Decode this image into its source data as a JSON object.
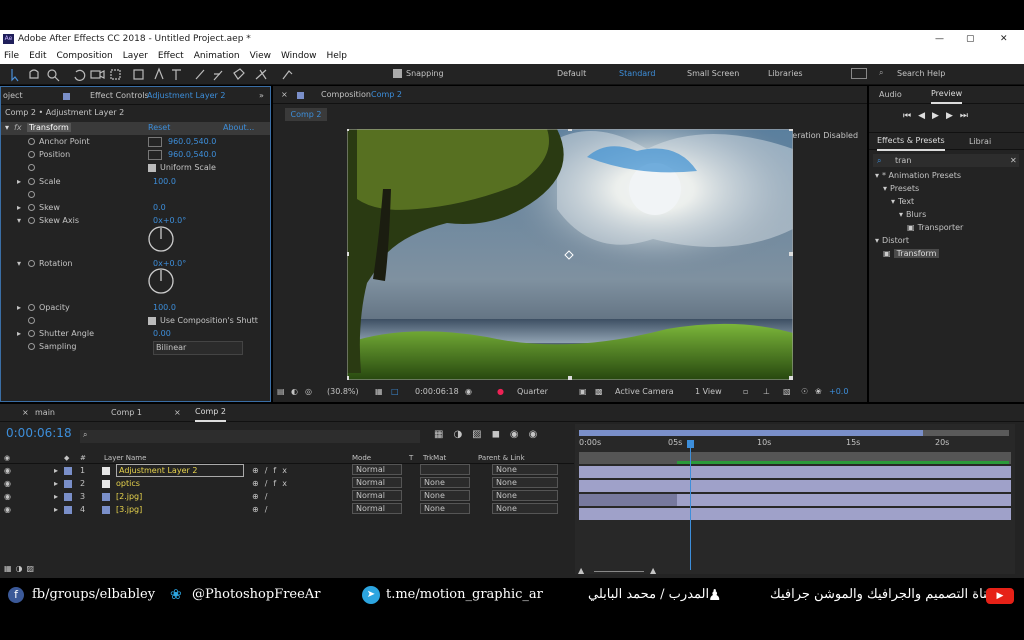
{
  "window": {
    "app_icon": "Ae",
    "title": "Adobe After Effects CC 2018 - Untitled Project.aep *",
    "min": "—",
    "max": "▢",
    "close": "✕"
  },
  "menu": [
    "File",
    "Edit",
    "Composition",
    "Layer",
    "Effect",
    "Animation",
    "View",
    "Window",
    "Help"
  ],
  "toolbar": {
    "snapping": "Snapping",
    "workspaces": [
      "Default",
      "Standard",
      "Small Screen",
      "Libraries"
    ],
    "active_workspace": "Standard",
    "search_help": "Search Help"
  },
  "effect_controls": {
    "project_tab": "oject",
    "tab_label": "Effect Controls",
    "tab_layer": "Adjustment Layer 2",
    "comp_layer": "Comp 2 • Adjustment Layer 2",
    "fx": "fx",
    "effect_name": "Transform",
    "reset": "Reset",
    "about": "About...",
    "props": [
      {
        "name": "Anchor Point",
        "value": "960.0,540.0"
      },
      {
        "name": "Position",
        "value": "960.0,540.0"
      },
      {
        "name": "",
        "value": "Uniform Scale",
        "checkbox": true
      },
      {
        "name": "Scale",
        "value": "100.0"
      },
      {
        "name": "",
        "value": ""
      },
      {
        "name": "Skew",
        "value": "0.0"
      },
      {
        "name": "Skew Axis",
        "value": "0x+0.0°"
      },
      {
        "name": "Rotation",
        "value": "0x+0.0°"
      },
      {
        "name": "Opacity",
        "value": "100.0"
      },
      {
        "name": "",
        "value": "Use Composition's Shutt",
        "checkbox": true
      },
      {
        "name": "Shutter Angle",
        "value": "0.00"
      },
      {
        "name": "Sampling",
        "value": "Bilinear",
        "dropdown": true
      }
    ]
  },
  "composition": {
    "tab_label": "Composition",
    "tab_comp": "Comp 2",
    "sub_tab": "Comp 2",
    "accel": "Display Acceleration Disabled",
    "footer": {
      "zoom": "(30.8%)",
      "timecode": "0:00:06:18",
      "resolution": "Quarter",
      "camera": "Active Camera",
      "view": "1 View",
      "exposure": "+0.0"
    }
  },
  "right_panel": {
    "tabs": [
      "Audio",
      "Preview"
    ],
    "effects_tab": "Effects & Presets",
    "libra_tab": "Librai",
    "search": "tran",
    "tree": [
      {
        "label": "* Animation Presets",
        "level": 0
      },
      {
        "label": "Presets",
        "level": 1
      },
      {
        "label": "Text",
        "level": 2
      },
      {
        "label": "Blurs",
        "level": 3
      },
      {
        "label": "Transporter",
        "level": 4
      },
      {
        "label": "Distort",
        "level": 0
      },
      {
        "label": "Transform",
        "level": 1,
        "selected": true
      }
    ]
  },
  "timeline": {
    "tabs": [
      "main",
      "Comp 1",
      "Comp 2"
    ],
    "active_tab": "Comp 2",
    "timecode": "0:00:06:18",
    "headers": {
      "num": "#",
      "layer_name": "Layer Name",
      "mode": "Mode",
      "t": "T",
      "trkmat": "TrkMat",
      "parent": "Parent & Link"
    },
    "ruler": [
      "0:00s",
      "05s",
      "10s",
      "15s",
      "20s"
    ],
    "current_time_fraction": 0.257,
    "layers": [
      {
        "num": "1",
        "name": "Adjustment Layer 2",
        "mode": "Normal",
        "trkmat": "",
        "parent": "None",
        "color": "#e6e6e6"
      },
      {
        "num": "2",
        "name": "optics",
        "mode": "Normal",
        "trkmat": "None",
        "parent": "None",
        "color": "#e6e6e6"
      },
      {
        "num": "3",
        "name": "[2.jpg]",
        "mode": "Normal",
        "trkmat": "None",
        "parent": "None",
        "color": "#7a8fc9"
      },
      {
        "num": "4",
        "name": "[3.jpg]",
        "mode": "Normal",
        "trkmat": "None",
        "parent": "None",
        "color": "#7a8fc9"
      }
    ]
  },
  "banner": {
    "fb": "fb/groups/elbabley",
    "twitter": "@PhotoshopFreeAr",
    "telegram": "t.me/motion_graphic_ar",
    "trainer": "المدرب / محمد البابلي",
    "channel": "قناة التصميم والجرافيك والموشن جرافيك"
  },
  "colors": {
    "accent": "#3d8eda",
    "panel": "#232323",
    "label_yellow": "#e8d44d",
    "youtube": "#e62117",
    "telegram": "#2ca5e0",
    "facebook": "#3b5998"
  }
}
